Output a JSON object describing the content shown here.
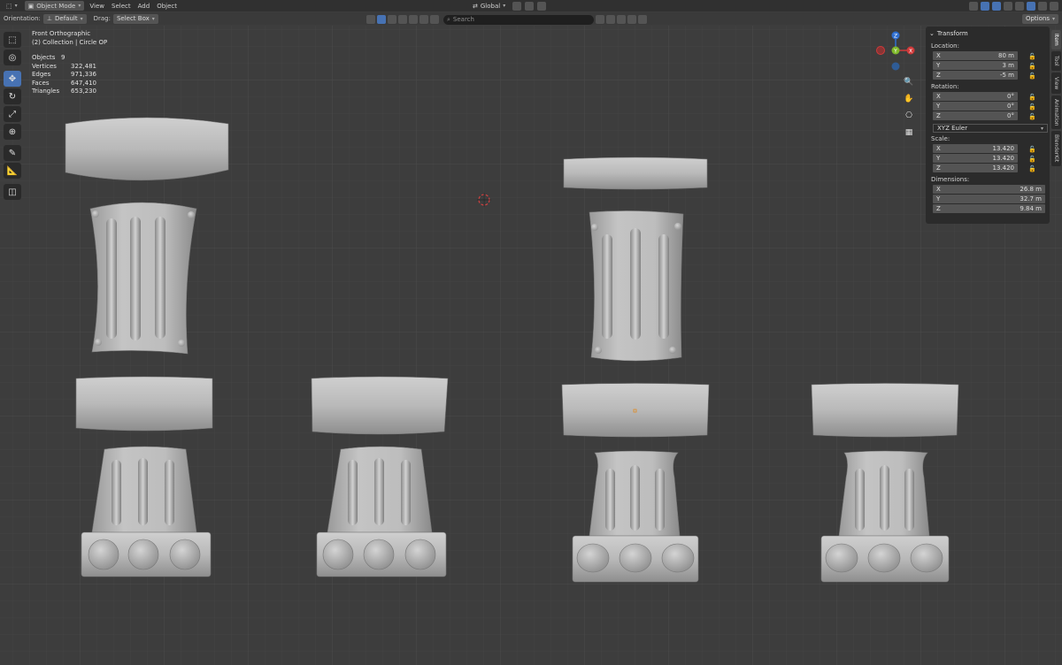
{
  "header": {
    "mode_label": "Object Mode",
    "menus": [
      "View",
      "Select",
      "Add",
      "Object"
    ],
    "transform_orientation": "Global",
    "right_options": "Options"
  },
  "toolbar": {
    "orientation_label": "Orientation:",
    "orientation_value": "Default",
    "drag_label": "Drag:",
    "drag_value": "Select Box",
    "search_placeholder": "Search"
  },
  "viewport": {
    "view_name": "Front Orthographic",
    "collection_line": "(2) Collection | Circle OP",
    "stats": [
      {
        "label": "Objects",
        "value": "9"
      },
      {
        "label": "Vertices",
        "value": "322,481"
      },
      {
        "label": "Edges",
        "value": "971,336"
      },
      {
        "label": "Faces",
        "value": "647,410"
      },
      {
        "label": "Triangles",
        "value": "653,230"
      }
    ]
  },
  "gizmo": {
    "z": "Z",
    "y": "Y",
    "x": "X"
  },
  "npanel": {
    "title": "Transform",
    "location_label": "Location:",
    "location": [
      {
        "axis": "X",
        "value": "80 m"
      },
      {
        "axis": "Y",
        "value": "3 m"
      },
      {
        "axis": "Z",
        "value": "-5 m"
      }
    ],
    "rotation_label": "Rotation:",
    "rotation": [
      {
        "axis": "X",
        "value": "0°"
      },
      {
        "axis": "Y",
        "value": "0°"
      },
      {
        "axis": "Z",
        "value": "0°"
      }
    ],
    "rotation_mode": "XYZ Euler",
    "scale_label": "Scale:",
    "scale": [
      {
        "axis": "X",
        "value": "13.420"
      },
      {
        "axis": "Y",
        "value": "13.420"
      },
      {
        "axis": "Z",
        "value": "13.420"
      }
    ],
    "dimensions_label": "Dimensions:",
    "dimensions": [
      {
        "axis": "X",
        "value": "26.8 m"
      },
      {
        "axis": "Y",
        "value": "32.7 m"
      },
      {
        "axis": "Z",
        "value": "9.84 m"
      }
    ]
  },
  "tabs": [
    "Item",
    "Tool",
    "View",
    "Animation",
    "BlenderKit"
  ]
}
